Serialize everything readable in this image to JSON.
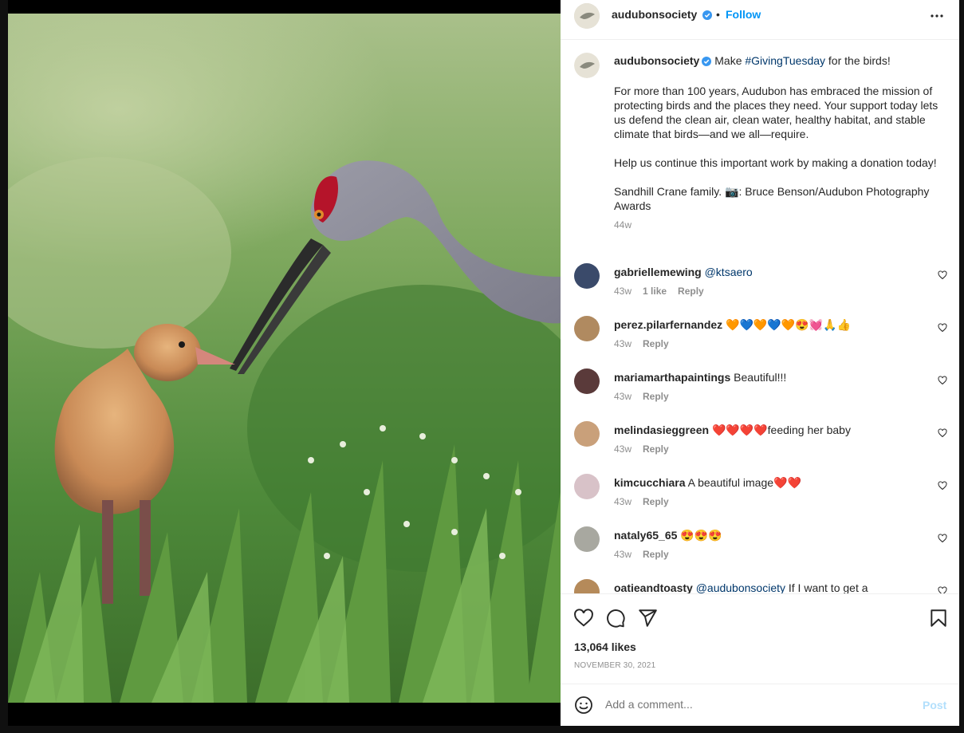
{
  "post": {
    "username": "audubonsociety",
    "follow_label": "Follow",
    "dot": "•",
    "caption": {
      "intro": "Make ",
      "hashtag": "#GivingTuesday",
      "intro_rest": " for the birds!",
      "para1": "For more than 100 years, Audubon has embraced the mission of protecting birds and the places they need. Your support today lets us defend the clean air, clean water, healthy habitat, and stable climate that birds—and we all—require.",
      "para2": "Help us continue this important work by making a donation today!",
      "para3": "Sandhill Crane family. 📷: Bruce Benson/Audubon Photography Awards",
      "time": "44w"
    },
    "comments": [
      {
        "user": "gabriellemewing",
        "mention": "@ktsaero",
        "text": "",
        "time": "43w",
        "likes": "1 like",
        "reply": "Reply"
      },
      {
        "user": "perez.pilarfernandez",
        "mention": "",
        "text": "🧡💙🧡💙🧡😍💓🙏👍",
        "time": "43w",
        "likes": "",
        "reply": "Reply"
      },
      {
        "user": "mariamarthapaintings",
        "mention": "",
        "text": "Beautiful!!!",
        "time": "43w",
        "likes": "",
        "reply": "Reply"
      },
      {
        "user": "melindasieggreen",
        "mention": "",
        "text": "❤️❤️❤️❤️feeding her baby",
        "time": "43w",
        "likes": "",
        "reply": "Reply"
      },
      {
        "user": "kimcucchiara",
        "mention": "",
        "text": "A beautiful image❤️❤️",
        "time": "43w",
        "likes": "",
        "reply": "Reply"
      },
      {
        "user": "nataly65_65",
        "mention": "",
        "text": "😍😍😍",
        "time": "43w",
        "likes": "",
        "reply": "Reply"
      },
      {
        "user": "oatieandtoasty",
        "mention": "@audubonsociety",
        "text": " If I want to get a",
        "time": "",
        "likes": "",
        "reply": ""
      }
    ],
    "likes_count": "13,064 likes",
    "date": "NOVEMBER 30, 2021",
    "add_comment_placeholder": "Add a comment...",
    "post_label": "Post"
  },
  "icons": {
    "like": "heart-icon",
    "comment": "comment-icon",
    "share": "paper-plane-icon",
    "save": "bookmark-icon",
    "more": "more-options-icon",
    "emoji": "emoji-icon",
    "verified": "verified-badge-icon"
  },
  "colors": {
    "accent": "#0095f6",
    "link": "#00376b",
    "muted": "#8e8e8e",
    "post_disabled": "#b2dffc"
  }
}
